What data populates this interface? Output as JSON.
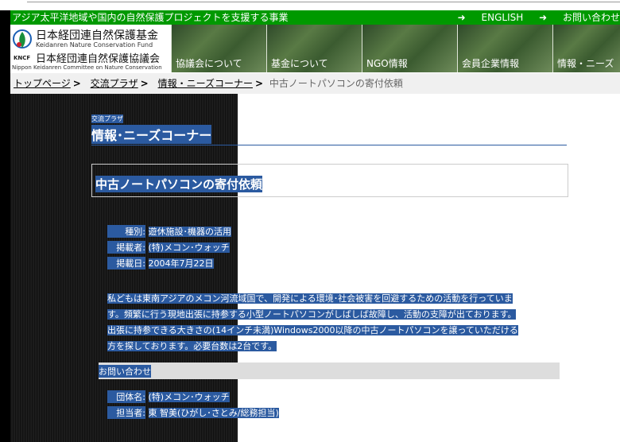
{
  "top_bar": {
    "tagline": "アジア太平洋地域や国内の自然保護プロジェクトを支援する事業",
    "english_link": "ENGLISH",
    "contact_link": "お問い合わせ"
  },
  "logo": {
    "name_jp_fund": "日本経団連自然保護基金",
    "name_en_fund": "Keidanren Nature Conservation Fund",
    "name_jp_committee": "日本経団連自然保護協議会",
    "name_en_committee": "Nippon Keidanren Committee on Nature Conservation",
    "abbr": "KNCF"
  },
  "nav": [
    {
      "label": "協議会について"
    },
    {
      "label": "基金について"
    },
    {
      "label": "NGO情報"
    },
    {
      "label": "会員企業情報"
    },
    {
      "label": "情報・ニーズ"
    }
  ],
  "breadcrumbs": [
    {
      "label": "トップページ"
    },
    {
      "label": "交流プラザ"
    },
    {
      "label": "情報・ニーズコーナー"
    }
  ],
  "breadcrumb_current": "中古ノートパソコンの寄付依頼",
  "section": {
    "parent": "交流プラザ",
    "title": "情報･ニーズコーナー"
  },
  "article": {
    "title": "中古ノートパソコンの寄付依頼",
    "meta": [
      {
        "key": "種別:",
        "value": "遊休施設･機器の活用"
      },
      {
        "key": "掲載者:",
        "value": "(特)メコン･ウォッチ"
      },
      {
        "key": "掲載日:",
        "value": "2004年7月22日"
      }
    ],
    "body_lines": [
      "私どもは東南アジアのメコン河流域国で、開発による環境･社会被害を回避するための活動を行っていま",
      "す。頻繁に行う現地出張に持参する小型ノートパソコンがしばしば故障し、活動の支障が出ております。",
      "出張に持参できる大きさの(14インチ未満)Windows2000以降の中古ノートパソコンを譲っていただける",
      "方を探しております。必要台数は2台です。"
    ],
    "contact_heading": "お問い合わせ",
    "contact": [
      {
        "key": "団体名:",
        "value": "(特)メコン･ウォッチ"
      },
      {
        "key": "担当者:",
        "value": "東 智美(ひがし･さとみ/総務担当)"
      }
    ]
  }
}
